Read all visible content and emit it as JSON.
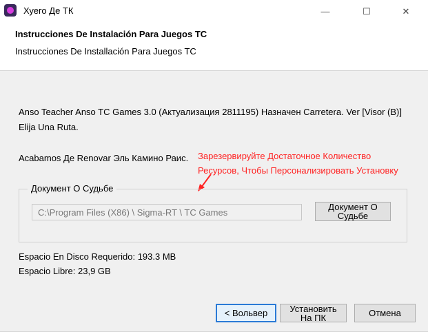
{
  "window": {
    "title": "Хуего Де ТК",
    "controls": {
      "minimize": "—",
      "maximize": "☐",
      "close": "✕"
    }
  },
  "header": {
    "title": "Instrucciones De Instalación Para Juegos TC",
    "subtitle": "Instrucciones De Installación Para Juegos TC"
  },
  "body": {
    "line1": "Anso Teacher Anso TC Games 3.0 (Актуализация 2811195) Назначен Carretera. Ver [Visor (B)]",
    "line2": "Elija Una Ruta.",
    "line3": "Acabamos Де Renovar Эль Камино Раис."
  },
  "annotation": {
    "line1": "Зарезервируйте Достаточное Количество",
    "line2": "Ресурсов, Чтобы Персонализировать Установку",
    "color": "#ff2222"
  },
  "destination": {
    "group_label": "Документ О Судьбе",
    "path_value": "C:\\Program Files (X86) \\ Sigma-RT \\ TC Games",
    "browse_label_line1": "Документ О",
    "browse_label_line2": "Судьбе"
  },
  "disk": {
    "required": "Espacio En Disco Requerido: 193.3 MB",
    "free": "Espacio Libre:  23,9 GB"
  },
  "buttons": {
    "back": "< Вольвер",
    "install_line1": "Установить",
    "install_line2": "На ПК",
    "cancel": "Отмена"
  },
  "colors": {
    "accent": "#2a7ad6",
    "app_icon": "#d83be0"
  },
  "icons": {
    "app": "tc-games-app-icon",
    "arrow": "red-arrow-icon"
  }
}
